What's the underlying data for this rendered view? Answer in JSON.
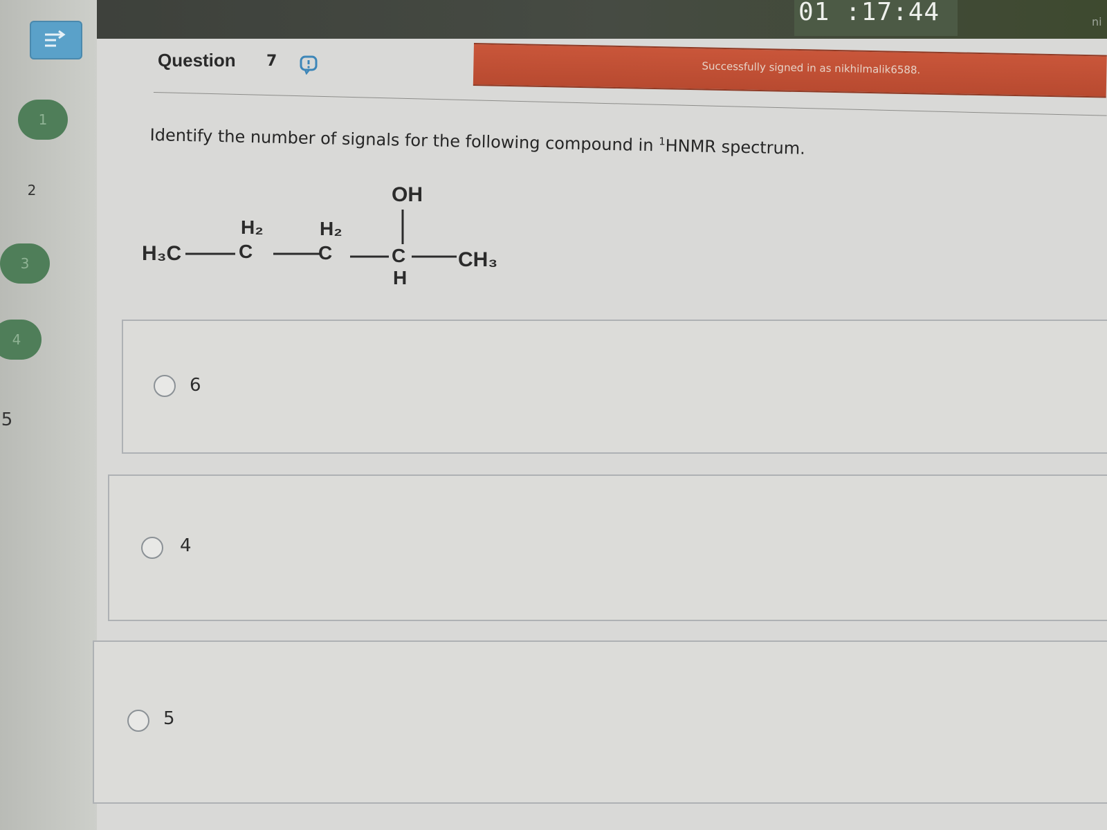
{
  "timer": "01 :17:44",
  "corner_text": "ni",
  "signin": {
    "message": "Successfully signed in as nikhilmalik6588."
  },
  "nav": {
    "toggle_icon": "list-arrow-icon",
    "items": [
      {
        "label": "1",
        "state": "answered"
      },
      {
        "label": "2",
        "state": "unanswered"
      },
      {
        "label": "3",
        "state": "answered"
      },
      {
        "label": "4",
        "state": "answered"
      },
      {
        "label": "5",
        "state": "unanswered"
      }
    ]
  },
  "question": {
    "title": "Question",
    "number": "7",
    "info_icon": "info-bubble-icon",
    "prompt_main": "Identify the number of signals for the following compound in ",
    "prompt_sup": "1",
    "prompt_tail": "HNMR spectrum."
  },
  "structure": {
    "h3c": "H₃C",
    "h2_a": "H₂",
    "c_a": "C",
    "h2_b": "H₂",
    "c_b": "C",
    "oh": "OH",
    "c_c": "C",
    "h": "H",
    "ch3": "CH₃"
  },
  "options": [
    {
      "label": "6",
      "selected": false
    },
    {
      "label": "4",
      "selected": false
    },
    {
      "label": "5",
      "selected": false
    }
  ],
  "colors": {
    "banner": "#c0502f",
    "timer_bg": "#4c5a45",
    "nav_done": "#4f7e59",
    "toggle": "#5aa1c9"
  }
}
